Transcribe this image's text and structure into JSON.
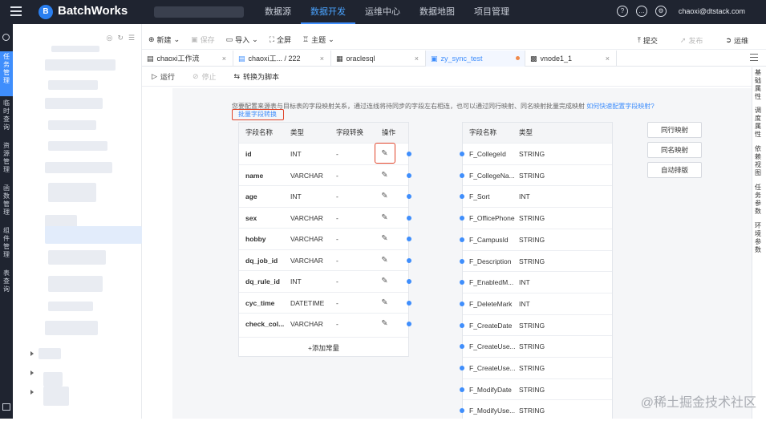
{
  "topbar": {
    "brand": "BatchWorks",
    "logo_letter": "B",
    "nav": [
      "数据源",
      "数据开发",
      "运维中心",
      "数据地图",
      "项目管理"
    ],
    "active_nav": "数据开发",
    "icons": [
      "help-icon",
      "message-icon",
      "settings-icon"
    ],
    "user": "chaoxi@dtstack.com"
  },
  "leftrail": {
    "items": [
      "任务管理",
      "临时查询",
      "资源管理",
      "函数管理",
      "组件管理",
      "表查询"
    ],
    "active": "任务管理"
  },
  "toolbar": {
    "new": "新建",
    "save": "保存",
    "import": "导入",
    "fullscreen": "全屏",
    "theme": "主题",
    "submit": "提交",
    "publish": "发布",
    "ops": "运维"
  },
  "tabs": [
    {
      "label": "chaoxi工作流",
      "close": "×"
    },
    {
      "label": "chaoxi工...  / 222",
      "close": "×"
    },
    {
      "label": "oraclesql",
      "close": "×"
    },
    {
      "label": "zy_sync_test",
      "close": ""
    },
    {
      "label": "vnode1_1",
      "close": "×"
    }
  ],
  "runbar": {
    "run": "运行",
    "stop": "停止",
    "convert": "转换为脚本"
  },
  "rightrail": [
    "基础属性",
    "调度属性",
    "依赖视图",
    "任务参数",
    "环境参数"
  ],
  "mapping": {
    "info": "您要配置来源表与目标表的字段映射关系，通过连线将待同步的字段左右相连，也可以通过同行映射、同名映射批量完成映射",
    "help_link": "如何快速配置字段映射?",
    "batch_convert": "批量字段转换",
    "source_headers": [
      "字段名称",
      "类型",
      "字段转换",
      "操作"
    ],
    "source_rows": [
      {
        "name": "id",
        "type": "INT",
        "conv": "-"
      },
      {
        "name": "name",
        "type": "VARCHAR",
        "conv": "-"
      },
      {
        "name": "age",
        "type": "INT",
        "conv": "-"
      },
      {
        "name": "sex",
        "type": "VARCHAR",
        "conv": "-"
      },
      {
        "name": "hobby",
        "type": "VARCHAR",
        "conv": "-"
      },
      {
        "name": "dq_job_id",
        "type": "VARCHAR",
        "conv": "-"
      },
      {
        "name": "dq_rule_id",
        "type": "INT",
        "conv": "-"
      },
      {
        "name": "cyc_time",
        "type": "DATETIME",
        "conv": "-"
      },
      {
        "name": "check_col...",
        "type": "VARCHAR",
        "conv": "-"
      }
    ],
    "add_constant": "+添加常量",
    "target_headers": [
      "字段名称",
      "类型"
    ],
    "target_rows": [
      {
        "name": "F_CollegeId",
        "type": "STRING"
      },
      {
        "name": "F_CollegeNa...",
        "type": "STRING"
      },
      {
        "name": "F_Sort",
        "type": "INT"
      },
      {
        "name": "F_OfficePhone",
        "type": "STRING"
      },
      {
        "name": "F_CampusId",
        "type": "STRING"
      },
      {
        "name": "F_Description",
        "type": "STRING"
      },
      {
        "name": "F_EnabledM...",
        "type": "INT"
      },
      {
        "name": "F_DeleteMark",
        "type": "INT"
      },
      {
        "name": "F_CreateDate",
        "type": "STRING"
      },
      {
        "name": "F_CreateUse...",
        "type": "STRING"
      },
      {
        "name": "F_CreateUse...",
        "type": "STRING"
      },
      {
        "name": "F_ModifyDate",
        "type": "STRING"
      },
      {
        "name": "F_ModifyUse...",
        "type": "STRING"
      }
    ],
    "buttons": [
      "同行映射",
      "同名映射",
      "自动排版"
    ]
  },
  "watermark": "@稀土掘金技术社区",
  "colors": {
    "accent": "#3f8efc",
    "topbar": "#1f2430",
    "highlight": "#e0442a"
  }
}
